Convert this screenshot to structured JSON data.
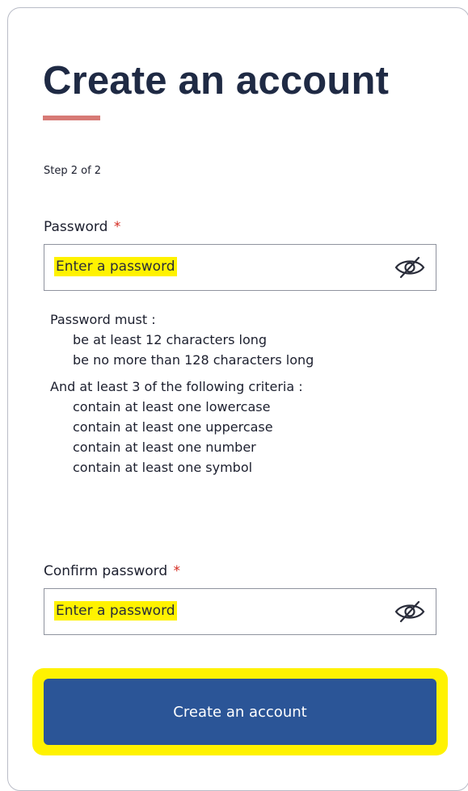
{
  "page": {
    "title": "Create an account",
    "step": "Step 2 of 2"
  },
  "password": {
    "label": "Password",
    "required_marker": "*",
    "placeholder": "Enter a password",
    "toggle_icon": "eye-slash-icon"
  },
  "requirements": {
    "intro": "Password must :",
    "must": [
      "be at least 12 characters long",
      "be no more than 128 characters long"
    ],
    "criteria_intro": "And at least 3 of the following criteria :",
    "criteria": [
      "contain at least one lowercase",
      "contain at least one uppercase",
      "contain at least one number",
      "contain at least one symbol"
    ]
  },
  "confirm_password": {
    "label": "Confirm password",
    "required_marker": "*",
    "placeholder": "Enter a password",
    "toggle_icon": "eye-slash-icon"
  },
  "submit": {
    "label": "Create an account"
  },
  "colors": {
    "title": "#1f2a44",
    "accent_underline": "#d77a76",
    "required": "#d42a1f",
    "highlight": "#fff200",
    "button": "#2b5597",
    "button_text": "#ffffff"
  }
}
